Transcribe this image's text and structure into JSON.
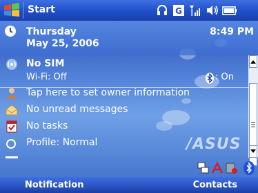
{
  "titlebar": {
    "title": "Start",
    "colors": {
      "bar": "#1f4fc8"
    }
  },
  "today": {
    "day": "Thursday",
    "date": "May 25, 2006",
    "time": "8:49 PM",
    "sim_title": "No SIM",
    "wifi": "Wi-Fi: Off",
    "bluetooth": ": On",
    "owner": "Tap here to set owner information",
    "messages": "No unread messages",
    "tasks": "No tasks",
    "profile": "Profile: Normal"
  },
  "wallpaper_brand": "/ASUS",
  "softkeys": {
    "left": "Notification",
    "right": "Contacts"
  },
  "icons": {
    "start": "windows-logo-icon",
    "status": [
      "headset-icon",
      "g-network-icon",
      "signal-icon",
      "speaker-icon",
      "battery-icon"
    ],
    "tray": [
      "network-icon",
      "acrobat-icon",
      "phone-off-icon",
      "bluetooth-icon"
    ]
  }
}
